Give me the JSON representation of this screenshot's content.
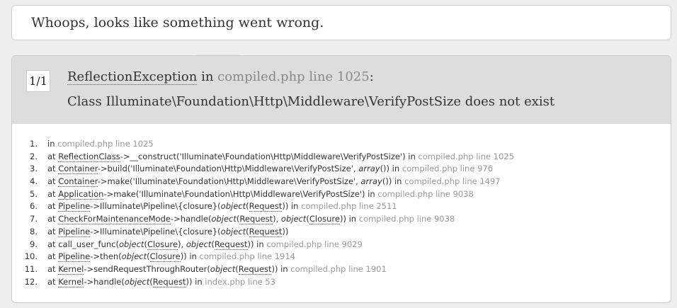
{
  "page": {
    "title": "Whoops, looks like something went wrong."
  },
  "exception": {
    "counter": "1/1",
    "class": "ReflectionException",
    "in_word": " in ",
    "location": "compiled.php line 1025",
    "colon": ":",
    "message": "Class Illuminate\\Foundation\\Http\\Middleware\\VerifyPostSize does not exist"
  },
  "trace": [
    {
      "num": "1.",
      "parts": [
        {
          "t": "in "
        },
        {
          "t": "compiled.php line 1025",
          "c": "file"
        }
      ]
    },
    {
      "num": "2.",
      "parts": [
        {
          "t": "at "
        },
        {
          "t": "ReflectionClass",
          "c": "abbr"
        },
        {
          "t": "->__construct('Illuminate\\Foundation\\Http\\Middleware\\VerifyPostSize') in "
        },
        {
          "t": "compiled.php line 1025",
          "c": "file"
        }
      ]
    },
    {
      "num": "3.",
      "parts": [
        {
          "t": "at "
        },
        {
          "t": "Container",
          "c": "abbr"
        },
        {
          "t": "->build('Illuminate\\Foundation\\Http\\Middleware\\VerifyPostSize', "
        },
        {
          "t": "array",
          "c": "i"
        },
        {
          "t": "()) in "
        },
        {
          "t": "compiled.php line 976",
          "c": "file"
        }
      ]
    },
    {
      "num": "4.",
      "parts": [
        {
          "t": "at "
        },
        {
          "t": "Container",
          "c": "abbr"
        },
        {
          "t": "->make('Illuminate\\Foundation\\Http\\Middleware\\VerifyPostSize', "
        },
        {
          "t": "array",
          "c": "i"
        },
        {
          "t": "()) in "
        },
        {
          "t": "compiled.php line 1497",
          "c": "file"
        }
      ]
    },
    {
      "num": "5.",
      "parts": [
        {
          "t": "at "
        },
        {
          "t": "Application",
          "c": "abbr"
        },
        {
          "t": "->make('Illuminate\\Foundation\\Http\\Middleware\\VerifyPostSize') in "
        },
        {
          "t": "compiled.php line 9038",
          "c": "file"
        }
      ]
    },
    {
      "num": "6.",
      "parts": [
        {
          "t": "at "
        },
        {
          "t": "Pipeline",
          "c": "abbr"
        },
        {
          "t": "->Illuminate\\Pipeline\\{closure}("
        },
        {
          "t": "object",
          "c": "i"
        },
        {
          "t": "("
        },
        {
          "t": "Request",
          "c": "abbr"
        },
        {
          "t": ")) in "
        },
        {
          "t": "compiled.php line 2511",
          "c": "file"
        }
      ]
    },
    {
      "num": "7.",
      "parts": [
        {
          "t": "at "
        },
        {
          "t": "CheckForMaintenanceMode",
          "c": "abbr"
        },
        {
          "t": "->handle("
        },
        {
          "t": "object",
          "c": "i"
        },
        {
          "t": "("
        },
        {
          "t": "Request",
          "c": "abbr"
        },
        {
          "t": "), "
        },
        {
          "t": "object",
          "c": "i"
        },
        {
          "t": "("
        },
        {
          "t": "Closure",
          "c": "abbr"
        },
        {
          "t": ")) in "
        },
        {
          "t": "compiled.php line 9038",
          "c": "file"
        }
      ]
    },
    {
      "num": "8.",
      "parts": [
        {
          "t": "at "
        },
        {
          "t": "Pipeline",
          "c": "abbr"
        },
        {
          "t": "->Illuminate\\Pipeline\\{closure}("
        },
        {
          "t": "object",
          "c": "i"
        },
        {
          "t": "("
        },
        {
          "t": "Request",
          "c": "abbr"
        },
        {
          "t": "))"
        }
      ]
    },
    {
      "num": "9.",
      "parts": [
        {
          "t": "at call_user_func("
        },
        {
          "t": "object",
          "c": "i"
        },
        {
          "t": "("
        },
        {
          "t": "Closure",
          "c": "abbr"
        },
        {
          "t": "), "
        },
        {
          "t": "object",
          "c": "i"
        },
        {
          "t": "("
        },
        {
          "t": "Request",
          "c": "abbr"
        },
        {
          "t": ")) in "
        },
        {
          "t": "compiled.php line 9029",
          "c": "file"
        }
      ]
    },
    {
      "num": "10.",
      "parts": [
        {
          "t": "at "
        },
        {
          "t": "Pipeline",
          "c": "abbr"
        },
        {
          "t": "->then("
        },
        {
          "t": "object",
          "c": "i"
        },
        {
          "t": "("
        },
        {
          "t": "Closure",
          "c": "abbr"
        },
        {
          "t": ")) in "
        },
        {
          "t": "compiled.php line 1914",
          "c": "file"
        }
      ]
    },
    {
      "num": "11.",
      "parts": [
        {
          "t": "at "
        },
        {
          "t": "Kernel",
          "c": "abbr"
        },
        {
          "t": "->sendRequestThroughRouter("
        },
        {
          "t": "object",
          "c": "i"
        },
        {
          "t": "("
        },
        {
          "t": "Request",
          "c": "abbr"
        },
        {
          "t": ")) in "
        },
        {
          "t": "compiled.php line 1901",
          "c": "file"
        }
      ]
    },
    {
      "num": "12.",
      "parts": [
        {
          "t": "at "
        },
        {
          "t": "Kernel",
          "c": "abbr"
        },
        {
          "t": "->handle("
        },
        {
          "t": "object",
          "c": "i"
        },
        {
          "t": "("
        },
        {
          "t": "Request",
          "c": "abbr"
        },
        {
          "t": ")) in "
        },
        {
          "t": "index.php line 53",
          "c": "file"
        }
      ]
    }
  ]
}
